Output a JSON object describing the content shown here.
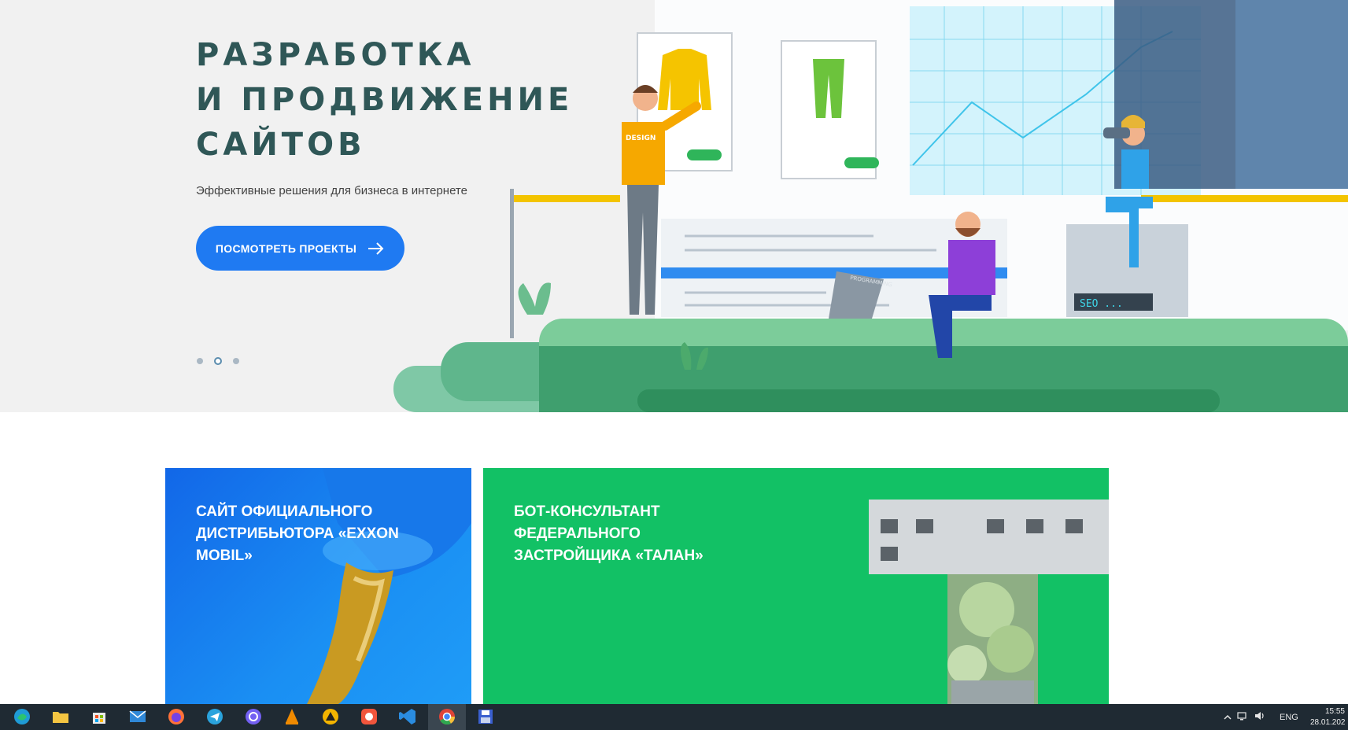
{
  "hero": {
    "title_lines": [
      "РАЗРАБОТКА",
      "И ПРОДВИЖЕНИЕ",
      "САЙТОВ"
    ],
    "subtitle": "Эффективные решения для бизнеса в интернете",
    "button_label": "ПОСМОТРЕТЬ ПРОЕКТЫ",
    "slider": {
      "total": 3,
      "active": 2
    },
    "illustration": {
      "shirt_label": "DESIGN",
      "laptop_label": "PROGRAMMING",
      "screen_label": "SEO ..."
    }
  },
  "projects": [
    {
      "title": "САЙТ ОФИЦИАЛЬНОГО ДИСТРИБЬЮТОРА «EXXON MOBIL»"
    },
    {
      "title": "БОТ-КОНСУЛЬТАНТ ФЕДЕРАЛЬНОГО ЗАСТРОЙЩИКА «ТАЛАН»"
    }
  ],
  "taskbar": {
    "apps": [
      "edge",
      "file-explorer",
      "store",
      "mail",
      "firefox",
      "telegram",
      "viber",
      "vlc",
      "aimp",
      "photo-app",
      "vscode",
      "chrome",
      "save-app"
    ],
    "active_app": "chrome",
    "language": "ENG",
    "time": "15:55",
    "date": "28.01.202"
  },
  "colors": {
    "title": "#2f5757",
    "button": "#1f7af2",
    "card_blue": "#1267e8",
    "card_green": "#12c165",
    "taskbar": "#1f2a33"
  }
}
